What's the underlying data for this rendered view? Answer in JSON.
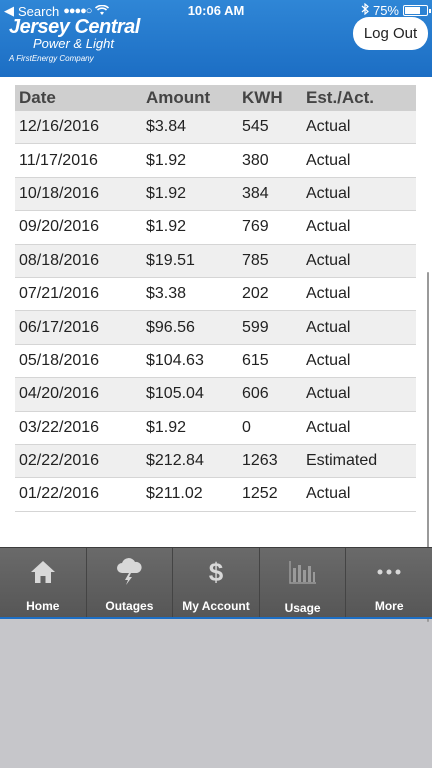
{
  "status_bar": {
    "back_label": "Search",
    "time": "10:06 AM",
    "battery": "75%"
  },
  "logo": {
    "line1": "Jersey Central",
    "line2": "Power & Light",
    "line3": "A FirstEnergy Company"
  },
  "header": {
    "logout_label": "Log Out"
  },
  "table": {
    "headers": [
      "Date",
      "Amount",
      "KWH",
      "Est./Act."
    ],
    "rows": [
      [
        "12/16/2016",
        "$3.84",
        "545",
        "Actual"
      ],
      [
        "11/17/2016",
        "$1.92",
        "380",
        "Actual"
      ],
      [
        "10/18/2016",
        "$1.92",
        "384",
        "Actual"
      ],
      [
        "09/20/2016",
        "$1.92",
        "769",
        "Actual"
      ],
      [
        "08/18/2016",
        "$19.51",
        "785",
        "Actual"
      ],
      [
        "07/21/2016",
        "$3.38",
        "202",
        "Actual"
      ],
      [
        "06/17/2016",
        "$96.56",
        "599",
        "Actual"
      ],
      [
        "05/18/2016",
        "$104.63",
        "615",
        "Actual"
      ],
      [
        "04/20/2016",
        "$105.04",
        "606",
        "Actual"
      ],
      [
        "03/22/2016",
        "$1.92",
        "0",
        "Actual"
      ],
      [
        "02/22/2016",
        "$212.84",
        "1263",
        "Estimated"
      ],
      [
        "01/22/2016",
        "$211.02",
        "1252",
        "Actual"
      ]
    ]
  },
  "tabs": [
    {
      "label": "Home",
      "icon": "home-icon"
    },
    {
      "label": "Outages",
      "icon": "storm-cloud-icon"
    },
    {
      "label": "My Account",
      "icon": "dollar-icon"
    },
    {
      "label": "Usage",
      "icon": "bar-chart-icon"
    },
    {
      "label": "More",
      "icon": "more-dots-icon"
    }
  ],
  "colors": {
    "header_blue": "#1c6ec4",
    "tab_bar": "#5e5e5e"
  }
}
